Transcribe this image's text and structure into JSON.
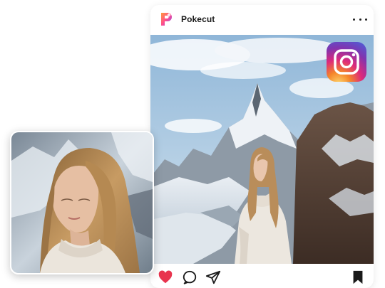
{
  "post": {
    "account_name": "Pokecut",
    "avatar_icon": "pokecut-logo-icon",
    "more_icon": "more-horizontal-icon",
    "photo": "woman-mountains-photo",
    "badge_icon": "instagram-logo-icon"
  },
  "actions": {
    "like_icon": "heart-filled-icon",
    "comment_icon": "comment-icon",
    "share_icon": "send-icon",
    "save_icon": "bookmark-filled-icon",
    "like_color": "#e8344e"
  },
  "overlay": {
    "photo": "woman-portrait-closeup-photo"
  },
  "colors": {
    "brand_gradient": [
      "#f58529",
      "#dd2a7b",
      "#8134af",
      "#515bd4"
    ],
    "pokecut_pink": "#ff4d8d",
    "pokecut_purple": "#7a4cff",
    "text": "#1a1a1a"
  }
}
